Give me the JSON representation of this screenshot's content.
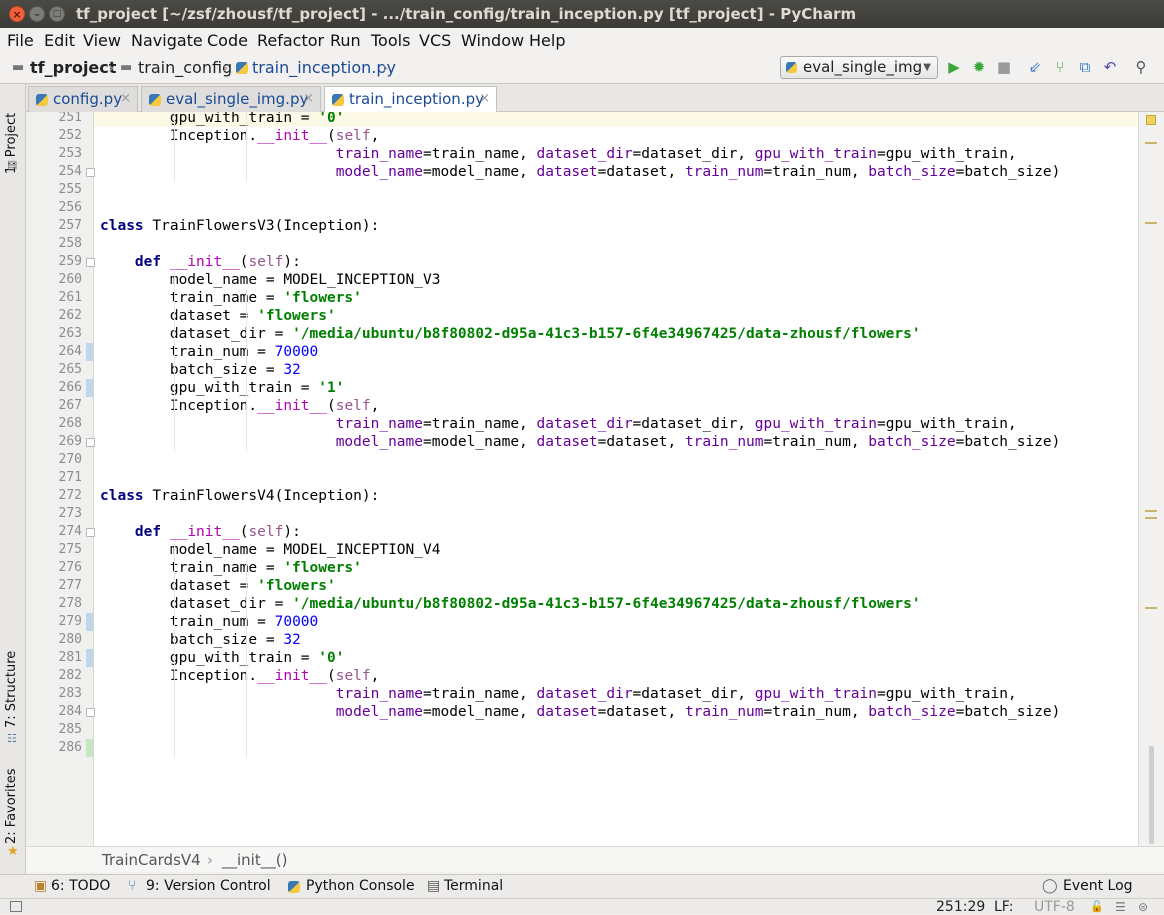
{
  "window": {
    "title": "tf_project [~/zsf/zhousf/tf_project] - .../train_config/train_inception.py [tf_project] - PyCharm"
  },
  "menu": [
    "File",
    "Edit",
    "View",
    "Navigate",
    "Code",
    "Refactor",
    "Run",
    "Tools",
    "VCS",
    "Window",
    "Help"
  ],
  "breadcrumb": {
    "project": "tf_project",
    "folder": "train_config",
    "file": "train_inception.py"
  },
  "run_config": {
    "selected": "eval_single_img"
  },
  "tabs": [
    {
      "label": "config.py",
      "active": false
    },
    {
      "label": "eval_single_img.py",
      "active": false
    },
    {
      "label": "train_inception.py",
      "active": true
    }
  ],
  "left_tool_windows": {
    "project": "1: Project",
    "structure": "7: Structure",
    "favorites": "2: Favorites"
  },
  "editor": {
    "current_line": 251,
    "lines": [
      {
        "n": "251",
        "t": "        gpu_with_train = '0'"
      },
      {
        "n": "252",
        "t": "        Inception.__init__(self,"
      },
      {
        "n": "253",
        "t": "                           train_name=train_name, dataset_dir=dataset_dir, gpu_with_train=gpu_with_train,"
      },
      {
        "n": "254",
        "t": "                           model_name=model_name, dataset=dataset, train_num=train_num, batch_size=batch_size)"
      },
      {
        "n": "255",
        "t": ""
      },
      {
        "n": "256",
        "t": ""
      },
      {
        "n": "257",
        "t": "class TrainFlowersV3(Inception):"
      },
      {
        "n": "258",
        "t": ""
      },
      {
        "n": "259",
        "t": "    def __init__(self):"
      },
      {
        "n": "260",
        "t": "        model_name = MODEL_INCEPTION_V3"
      },
      {
        "n": "261",
        "t": "        train_name = 'flowers'"
      },
      {
        "n": "262",
        "t": "        dataset = 'flowers'"
      },
      {
        "n": "263",
        "t": "        dataset_dir = '/media/ubuntu/b8f80802-d95a-41c3-b157-6f4e34967425/data-zhousf/flowers'"
      },
      {
        "n": "264",
        "t": "        train_num = 70000"
      },
      {
        "n": "265",
        "t": "        batch_size = 32"
      },
      {
        "n": "266",
        "t": "        gpu_with_train = '1'"
      },
      {
        "n": "267",
        "t": "        Inception.__init__(self,"
      },
      {
        "n": "268",
        "t": "                           train_name=train_name, dataset_dir=dataset_dir, gpu_with_train=gpu_with_train,"
      },
      {
        "n": "269",
        "t": "                           model_name=model_name, dataset=dataset, train_num=train_num, batch_size=batch_size)"
      },
      {
        "n": "270",
        "t": ""
      },
      {
        "n": "271",
        "t": ""
      },
      {
        "n": "272",
        "t": "class TrainFlowersV4(Inception):"
      },
      {
        "n": "273",
        "t": ""
      },
      {
        "n": "274",
        "t": "    def __init__(self):"
      },
      {
        "n": "275",
        "t": "        model_name = MODEL_INCEPTION_V4"
      },
      {
        "n": "276",
        "t": "        train_name = 'flowers'"
      },
      {
        "n": "277",
        "t": "        dataset = 'flowers'"
      },
      {
        "n": "278",
        "t": "        dataset_dir = '/media/ubuntu/b8f80802-d95a-41c3-b157-6f4e34967425/data-zhousf/flowers'"
      },
      {
        "n": "279",
        "t": "        train_num = 70000"
      },
      {
        "n": "280",
        "t": "        batch_size = 32"
      },
      {
        "n": "281",
        "t": "        gpu_with_train = '0'"
      },
      {
        "n": "282",
        "t": "        Inception.__init__(self,"
      },
      {
        "n": "283",
        "t": "                           train_name=train_name, dataset_dir=dataset_dir, gpu_with_train=gpu_with_train,"
      },
      {
        "n": "284",
        "t": "                           model_name=model_name, dataset=dataset, train_num=train_num, batch_size=batch_size)"
      },
      {
        "n": "285",
        "t": ""
      },
      {
        "n": "286",
        "t": ""
      }
    ]
  },
  "code_breadcrumb": {
    "class": "TrainCardsV4",
    "method": "__init__()"
  },
  "tool_windows": {
    "todo": "6: TODO",
    "vcs": "9: Version Control",
    "python_console": "Python Console",
    "terminal": "Terminal",
    "event_log": "Event Log"
  },
  "status": {
    "position": "251:29",
    "line_separator": "LF:",
    "encoding": "UTF-8"
  }
}
